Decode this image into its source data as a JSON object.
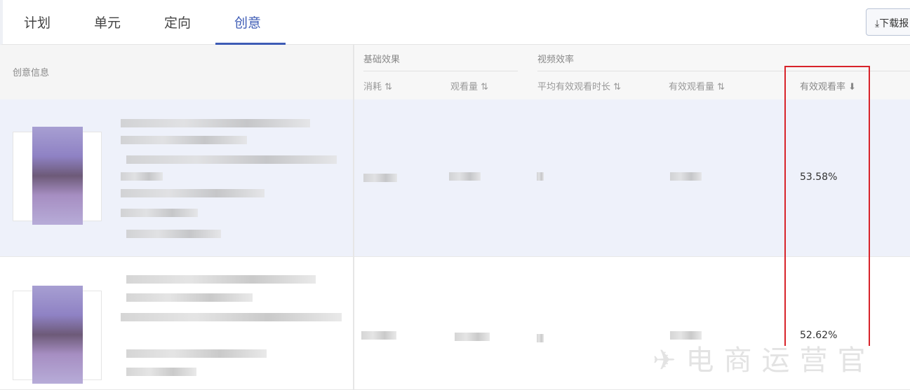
{
  "tabs": [
    {
      "label": "计划"
    },
    {
      "label": "单元"
    },
    {
      "label": "定向"
    },
    {
      "label": "创意",
      "active": true
    }
  ],
  "download_label": "下载报",
  "header": {
    "creative_info": "创意信息",
    "groups": [
      "基础效果",
      "视频效率"
    ],
    "columns": [
      "消耗",
      "观看量",
      "平均有效观看时长",
      "有效观看量",
      "有效观看率"
    ],
    "sort_icons": [
      "sort-icon",
      "sort-icon",
      "sort-icon",
      "sort-icon",
      "sort-desc-icon"
    ]
  },
  "rows": [
    {
      "effective_view_rate": "53.58%"
    },
    {
      "effective_view_rate": "52.62%"
    }
  ],
  "watermark": "电商运营官",
  "colors": {
    "accent": "#3d5bb5",
    "highlight": "#d8232a",
    "row_selected": "#eef1fa"
  }
}
